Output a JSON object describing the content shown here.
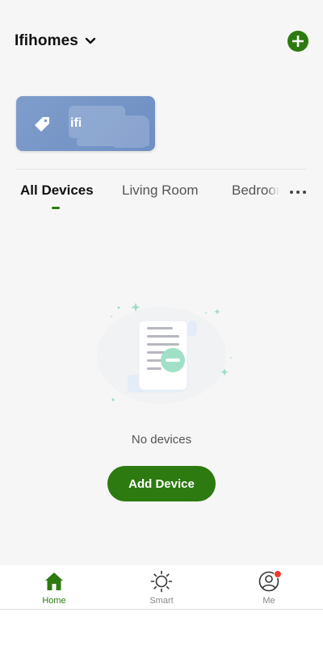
{
  "header": {
    "home_name": "Ifihomes"
  },
  "scene": {
    "label": "ifi"
  },
  "tabs": [
    {
      "label": "All Devices",
      "active": true
    },
    {
      "label": "Living Room",
      "active": false
    },
    {
      "label": "Bedroom",
      "active": false
    }
  ],
  "empty_state": {
    "message": "No devices",
    "button_label": "Add Device"
  },
  "bottom_nav": [
    {
      "label": "Home",
      "icon": "home-icon",
      "active": true
    },
    {
      "label": "Smart",
      "icon": "sun-icon",
      "active": false
    },
    {
      "label": "Me",
      "icon": "profile-icon",
      "active": false,
      "badge": true
    }
  ],
  "colors": {
    "accent": "#2d7a10",
    "scene_card": "#7f9dcb",
    "badge": "#ee3b2f",
    "background": "#f6f6f6"
  }
}
